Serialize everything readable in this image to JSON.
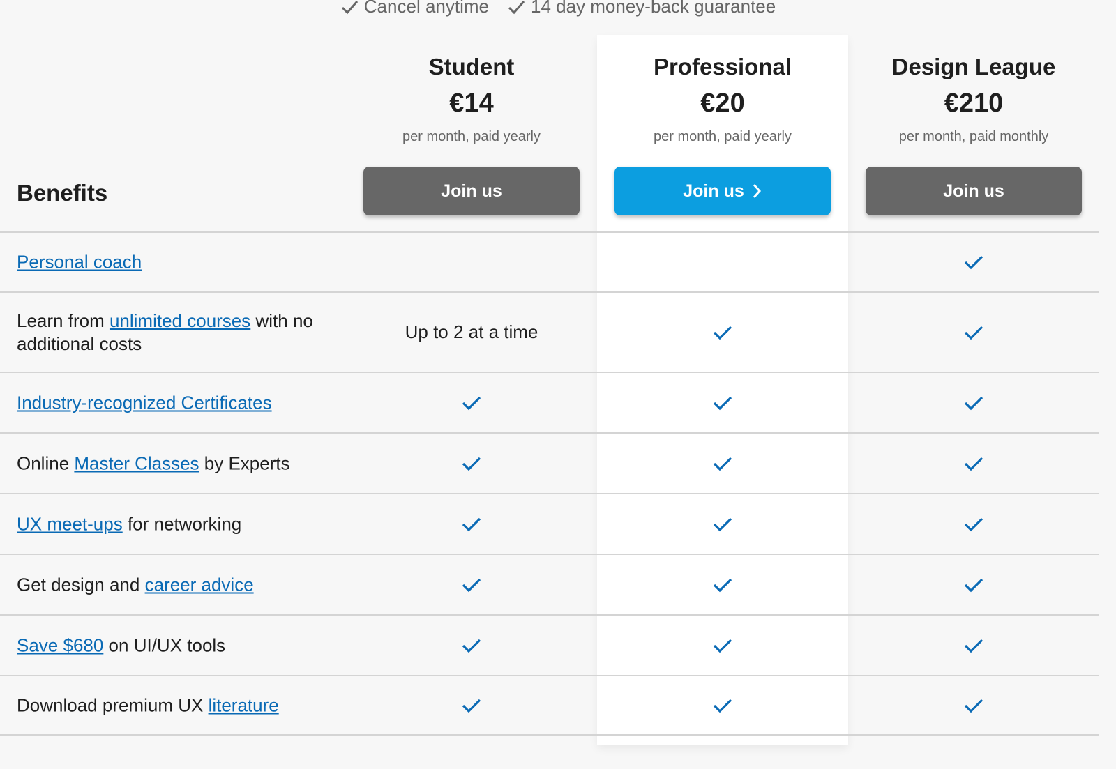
{
  "guarantees": [
    "Cancel anytime",
    "14 day money-back guarantee"
  ],
  "colors": {
    "accent": "#0c9ee0",
    "link": "#0a6ab5",
    "gray_button": "#676767",
    "check": "#0a6ab5"
  },
  "benefits_heading": "Benefits",
  "plans": [
    {
      "name": "Student",
      "price": "€14",
      "period": "per month, paid yearly",
      "cta": "Join us",
      "highlighted": false
    },
    {
      "name": "Professional",
      "price": "€20",
      "period": "per month, paid yearly",
      "cta": "Join us",
      "highlighted": true
    },
    {
      "name": "Design League",
      "price": "€210",
      "period": "per month, paid monthly",
      "cta": "Join us",
      "highlighted": false
    }
  ],
  "rows": [
    {
      "parts": [
        {
          "text": "Personal coach",
          "link": true
        }
      ],
      "values": [
        null,
        null,
        "check"
      ]
    },
    {
      "parts": [
        {
          "text": "Learn from ",
          "link": false
        },
        {
          "text": "unlimited courses",
          "link": true
        },
        {
          "text": " with no additional costs",
          "link": false
        }
      ],
      "values": [
        "Up to 2 at a time",
        "check",
        "check"
      ]
    },
    {
      "parts": [
        {
          "text": "Industry-recognized Certificates",
          "link": true
        }
      ],
      "values": [
        "check",
        "check",
        "check"
      ]
    },
    {
      "parts": [
        {
          "text": "Online ",
          "link": false
        },
        {
          "text": "Master Classes",
          "link": true
        },
        {
          "text": " by Experts",
          "link": false
        }
      ],
      "values": [
        "check",
        "check",
        "check"
      ]
    },
    {
      "parts": [
        {
          "text": "UX meet-ups",
          "link": true
        },
        {
          "text": " for networking",
          "link": false
        }
      ],
      "values": [
        "check",
        "check",
        "check"
      ]
    },
    {
      "parts": [
        {
          "text": "Get design and ",
          "link": false
        },
        {
          "text": "career advice",
          "link": true
        }
      ],
      "values": [
        "check",
        "check",
        "check"
      ]
    },
    {
      "parts": [
        {
          "text": "Save $680",
          "link": true
        },
        {
          "text": " on UI/UX tools",
          "link": false
        }
      ],
      "values": [
        "check",
        "check",
        "check"
      ]
    },
    {
      "parts": [
        {
          "text": "Download premium UX ",
          "link": false
        },
        {
          "text": "literature",
          "link": true
        }
      ],
      "values": [
        "check",
        "check",
        "check"
      ]
    }
  ]
}
